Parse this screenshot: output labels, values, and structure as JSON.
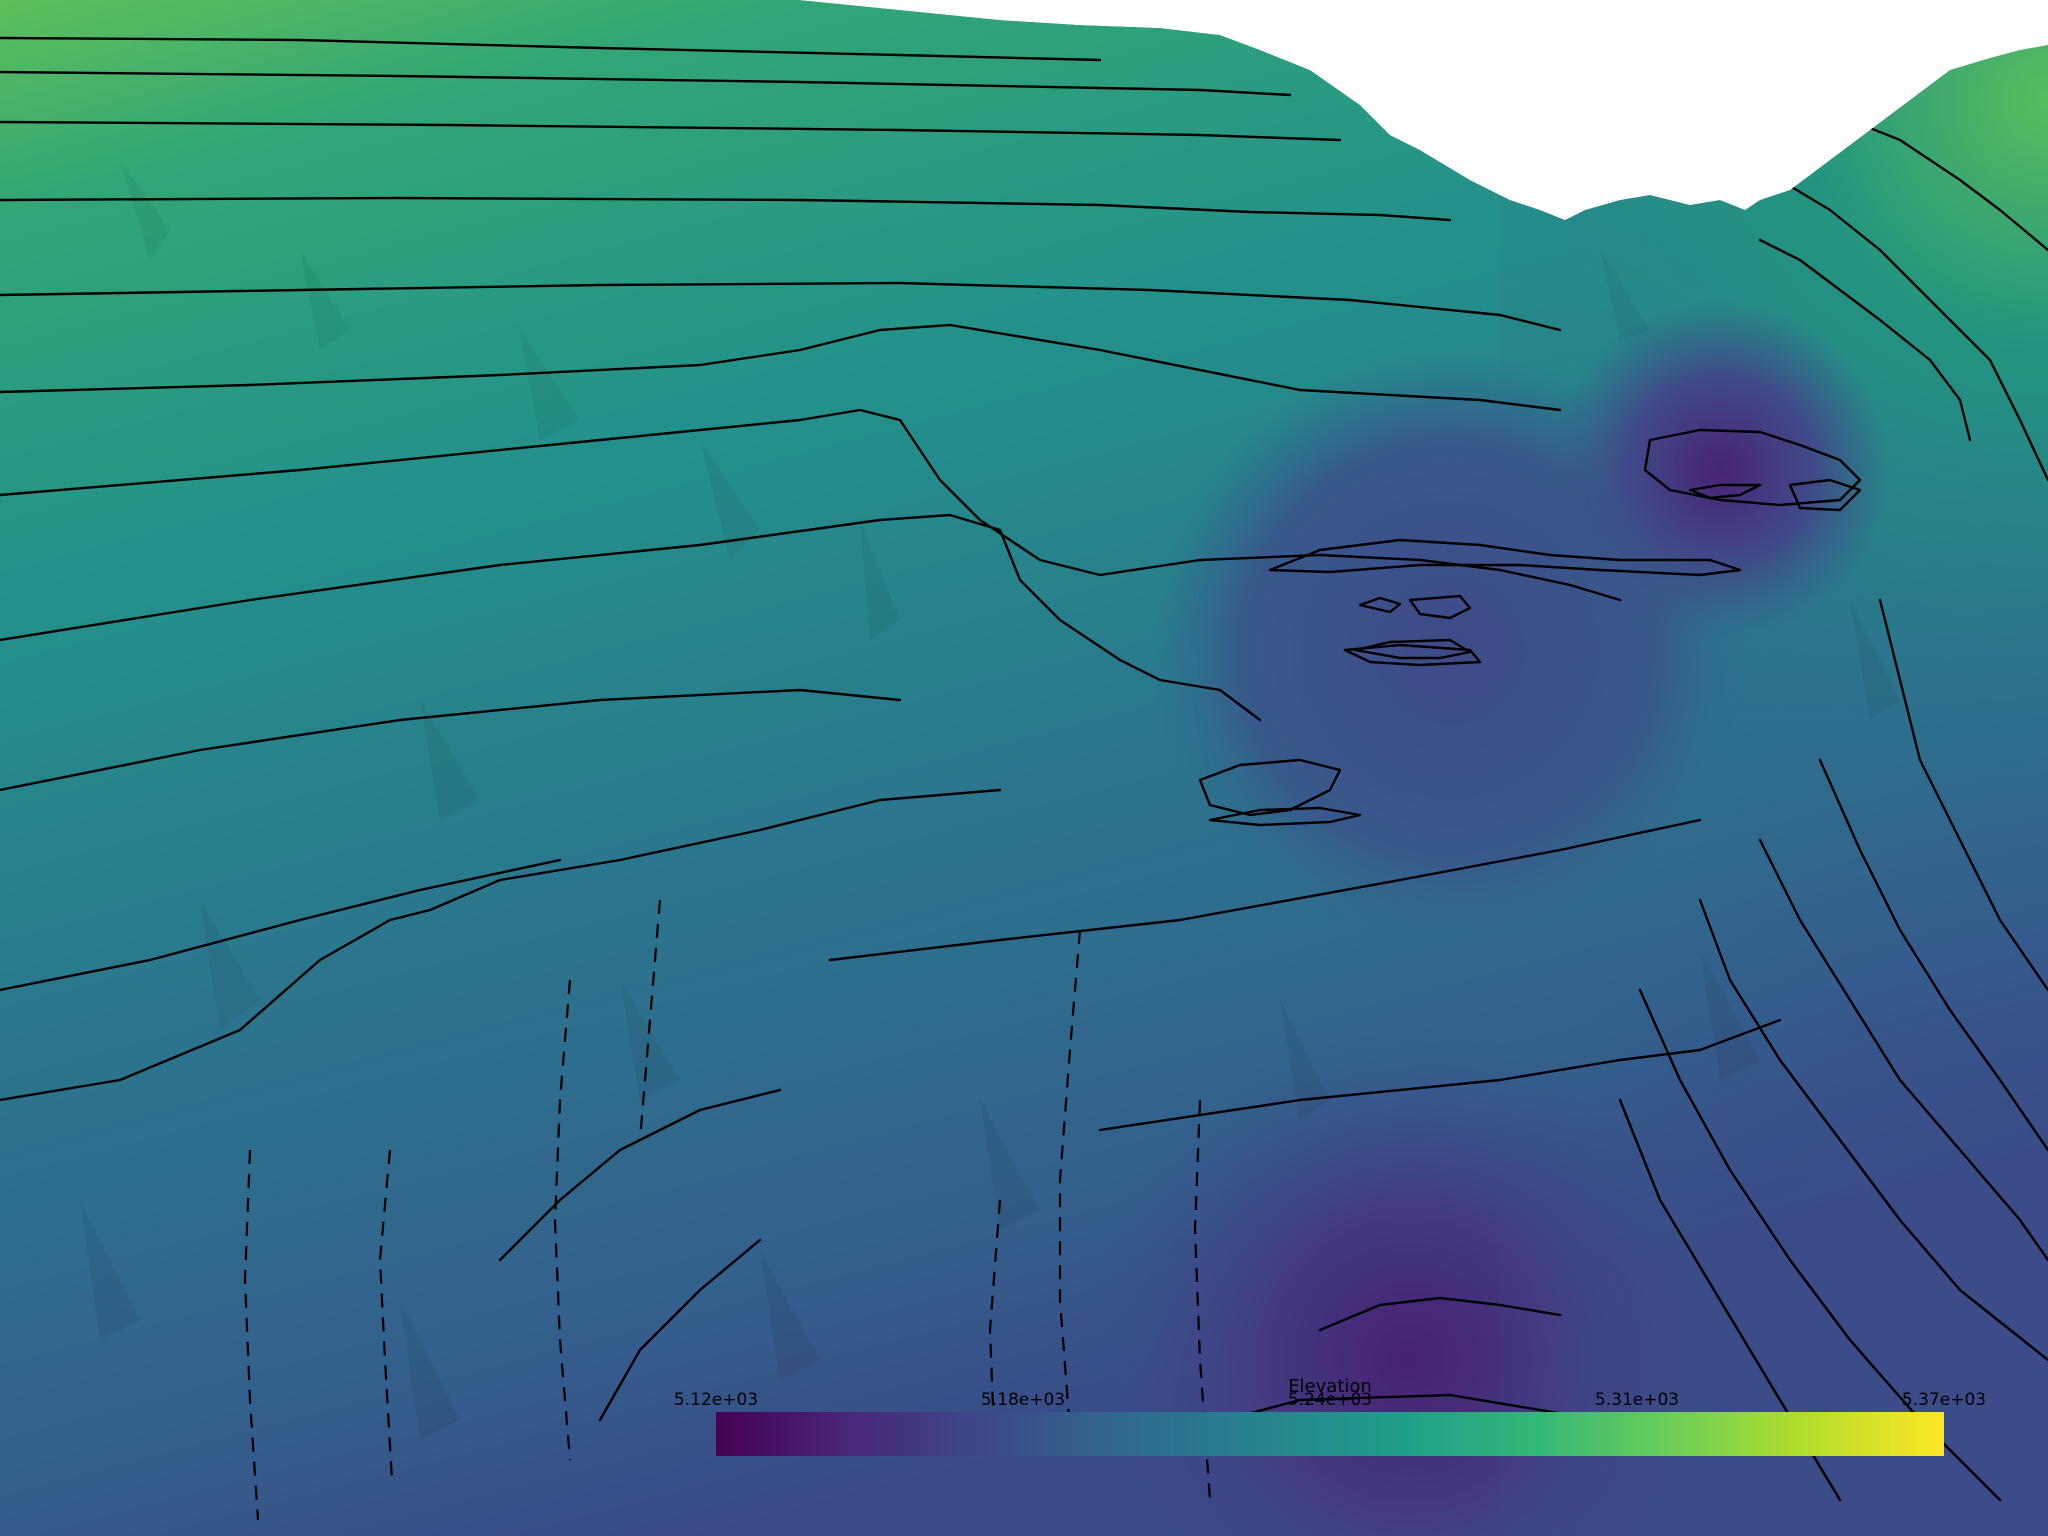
{
  "scalar_bar": {
    "title": "Elevation",
    "ticks": [
      "5.12e+03",
      "5.18e+03",
      "5.24e+03",
      "5.31e+03",
      "5.37e+03"
    ],
    "colormap": "viridis",
    "colors": [
      "#440154",
      "#482878",
      "#3e4989",
      "#31688e",
      "#26828e",
      "#1f9e89",
      "#35b779",
      "#6ece58",
      "#b5de2b",
      "#fde725"
    ]
  },
  "scene": {
    "background": "#ffffff",
    "surface": "3D terrain mesh colored by elevation with black contour lines",
    "contour_color": "#000000"
  }
}
